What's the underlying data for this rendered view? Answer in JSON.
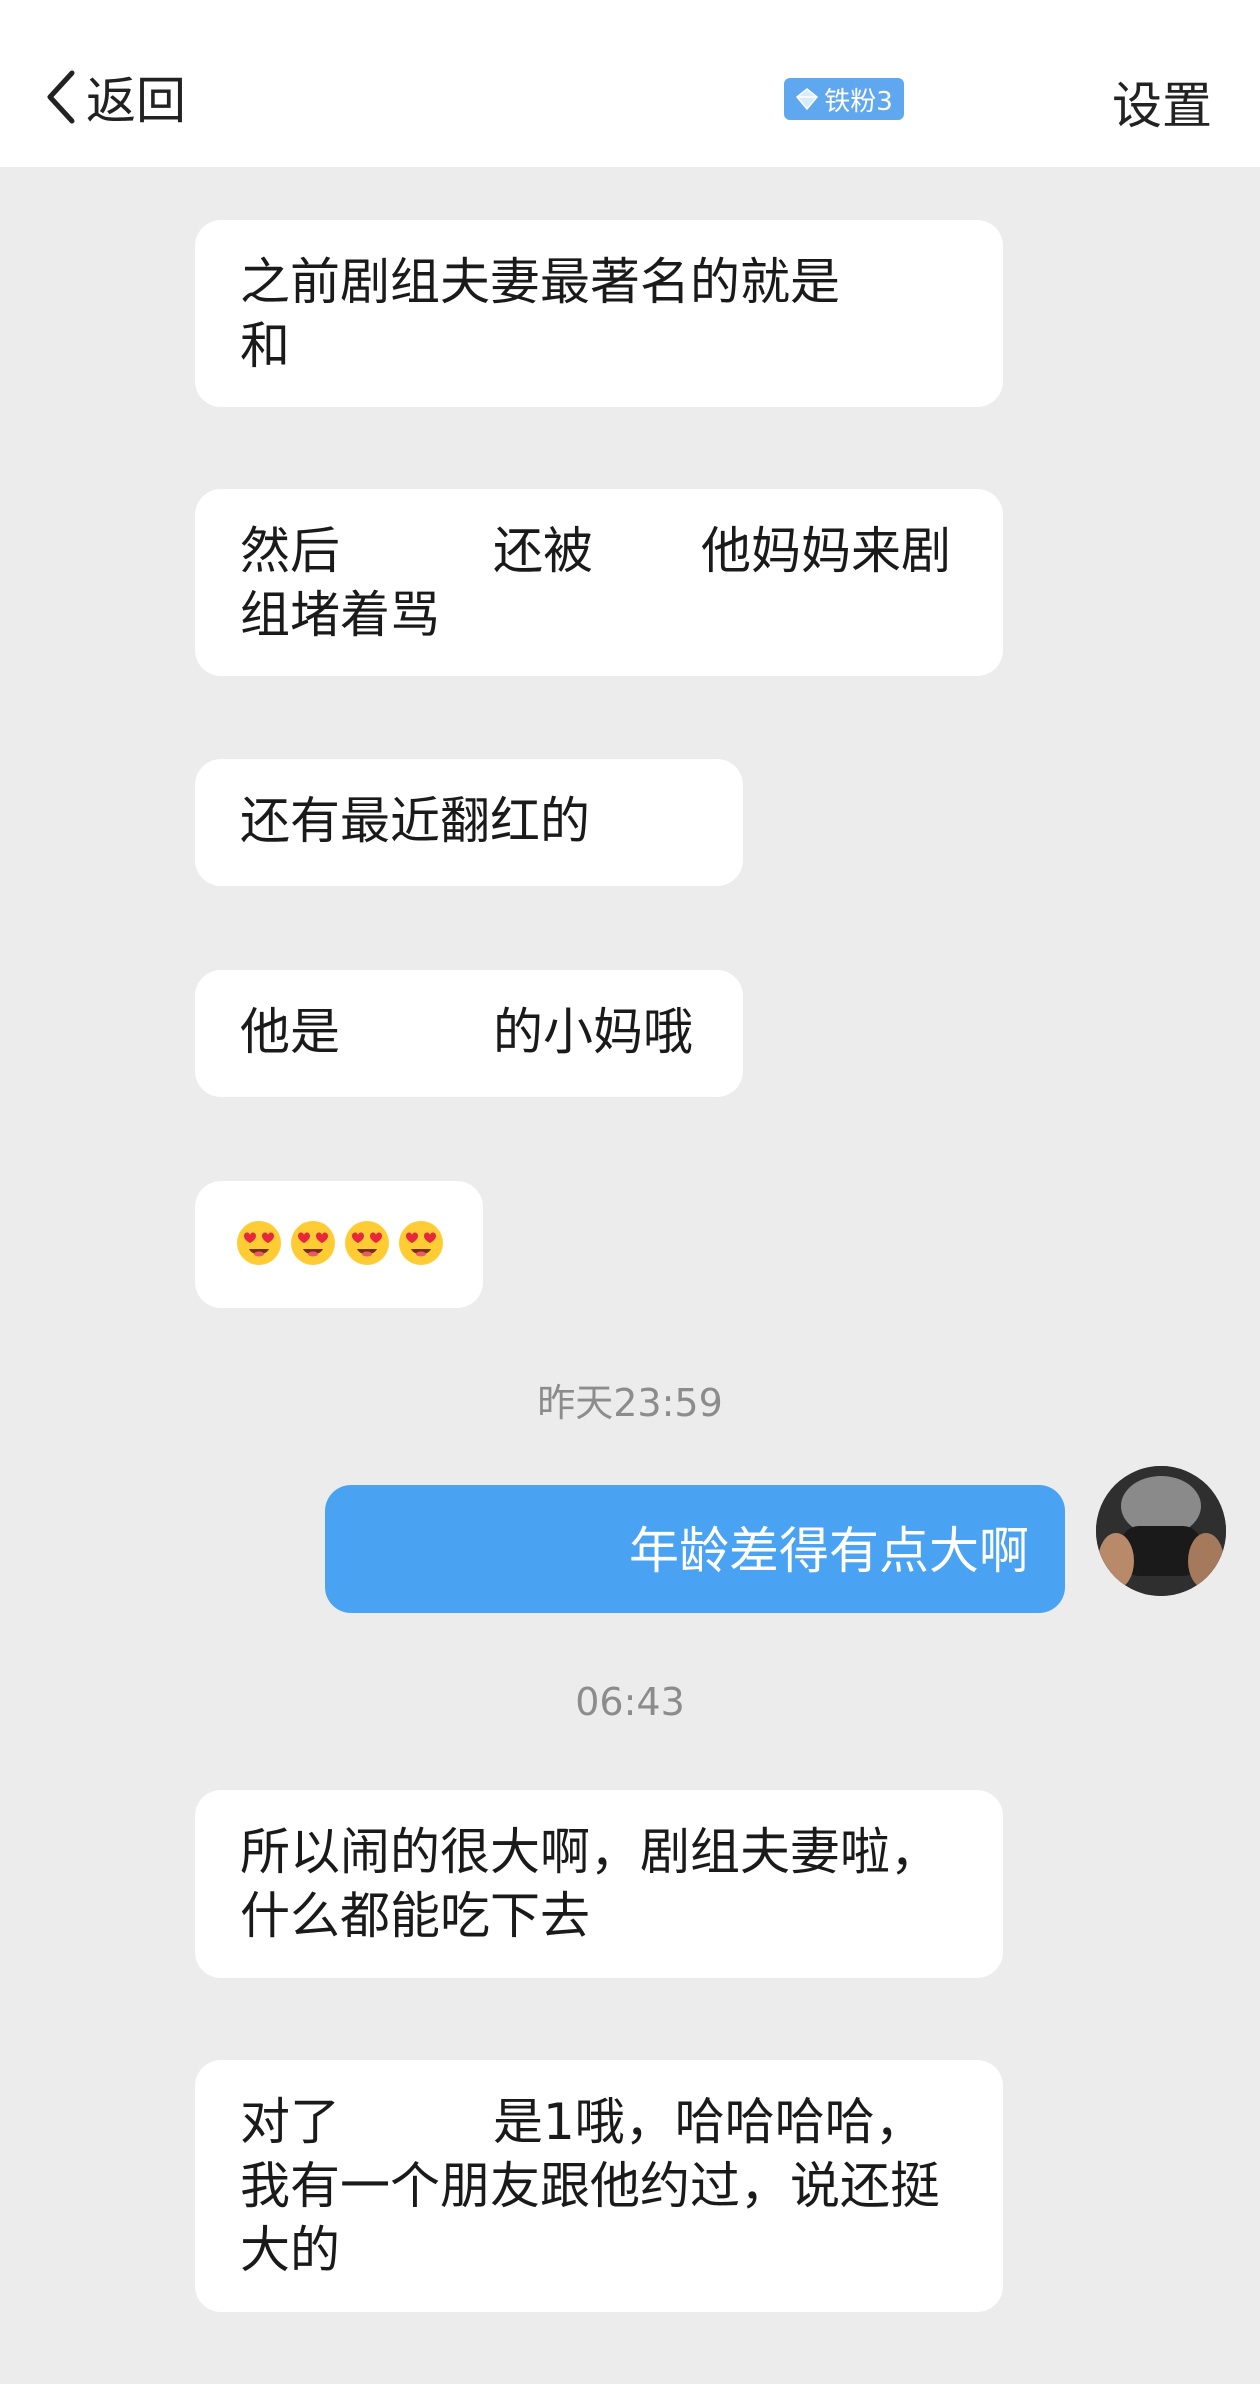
{
  "header": {
    "back_label": "返回",
    "badge_label": "铁粉3",
    "settings_label": "设置"
  },
  "messages": [
    {
      "from": "other",
      "lines": [
        "之前剧组夫妻最著名的就是",
        "和"
      ]
    },
    {
      "from": "other",
      "segments": [
        "然后",
        "还被",
        "他妈妈来剧"
      ],
      "line2": "组堵着骂"
    },
    {
      "from": "other",
      "lines": [
        "还有最近翻红的"
      ]
    },
    {
      "from": "other",
      "segments": [
        "他是",
        "的小妈哦"
      ]
    },
    {
      "from": "other",
      "emoji": [
        "heart-eyes-emoji",
        "heart-eyes-emoji",
        "heart-eyes-emoji",
        "heart-eyes-emoji"
      ]
    },
    {
      "from": "other",
      "lines": [
        "所以闹的很大啊，剧组夫妻啦，",
        "什么都能吃下去"
      ]
    },
    {
      "from": "other",
      "segments": [
        "对了",
        "是1哦，哈哈哈哈，"
      ],
      "line2": "我有一个朋友跟他约过，说还挺",
      "line3": "大的"
    }
  ],
  "timestamps": [
    "昨天23:59",
    "06:43"
  ],
  "my_message": "年龄差得有点大啊",
  "colors": {
    "my_bubble": "#4aa3f2",
    "badge": "#5fa8f0",
    "background": "#ececec"
  }
}
